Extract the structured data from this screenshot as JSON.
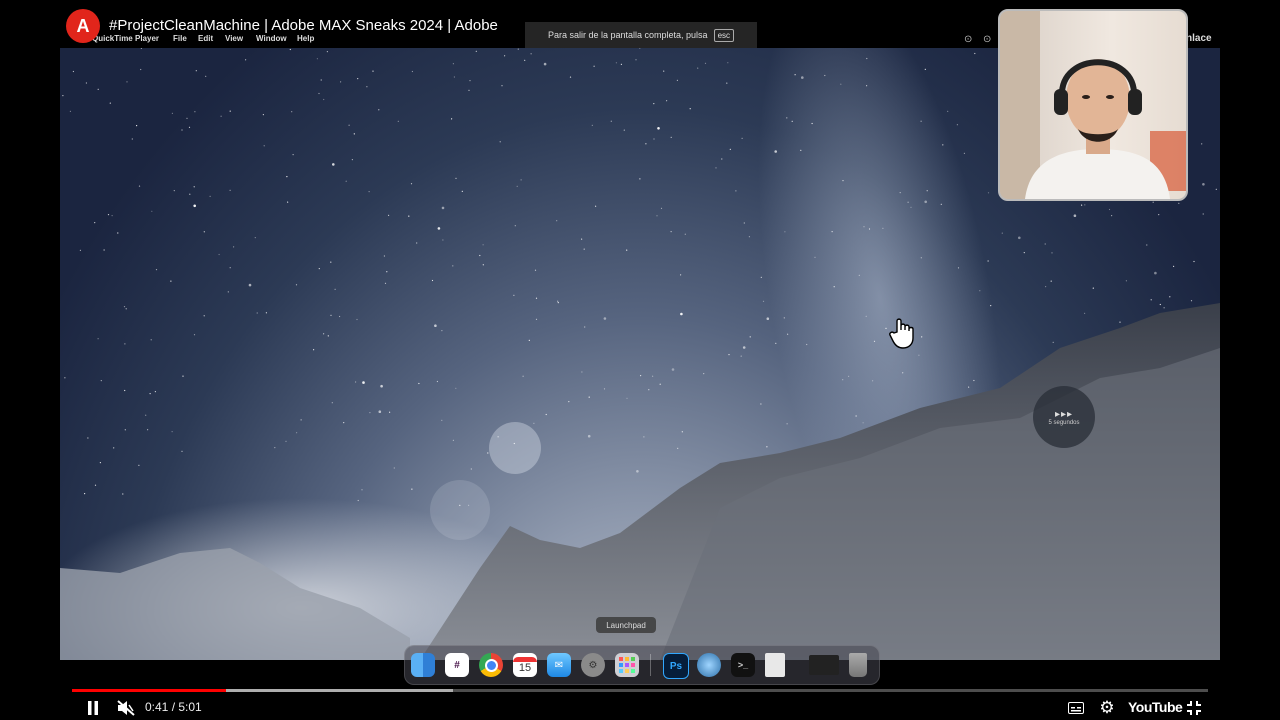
{
  "header": {
    "video_title": "#ProjectCleanMachine | Adobe MAX Sneaks 2024 | Adobe",
    "channel_logo_text": "A",
    "right_partial_text": "nlace"
  },
  "mac_menubar": {
    "items": [
      "QuickTime Player",
      "File",
      "Edit",
      "View",
      "Window",
      "Help"
    ]
  },
  "fullscreen_banner": {
    "text": "Para salir de la pantalla completa, pulsa",
    "key": "esc"
  },
  "skip_overlay": {
    "arrows": "▸▸▸",
    "label": "5 segundos"
  },
  "dock": {
    "tooltip": "Launchpad",
    "calendar_day": "15",
    "ps_label": "Ps"
  },
  "player": {
    "time": "0:41 / 5:01",
    "played_fraction": 0.136,
    "buffered_fraction": 0.335,
    "brand": "YouTube"
  },
  "icons": [
    "channel-logo-icon",
    "pause-icon",
    "mute-icon",
    "subtitles-icon",
    "settings-icon",
    "youtube-logo",
    "exit-fullscreen-icon",
    "hand-cursor-icon"
  ],
  "colors": {
    "progress_red": "#ff0000",
    "adobe_red": "#e1251b"
  }
}
